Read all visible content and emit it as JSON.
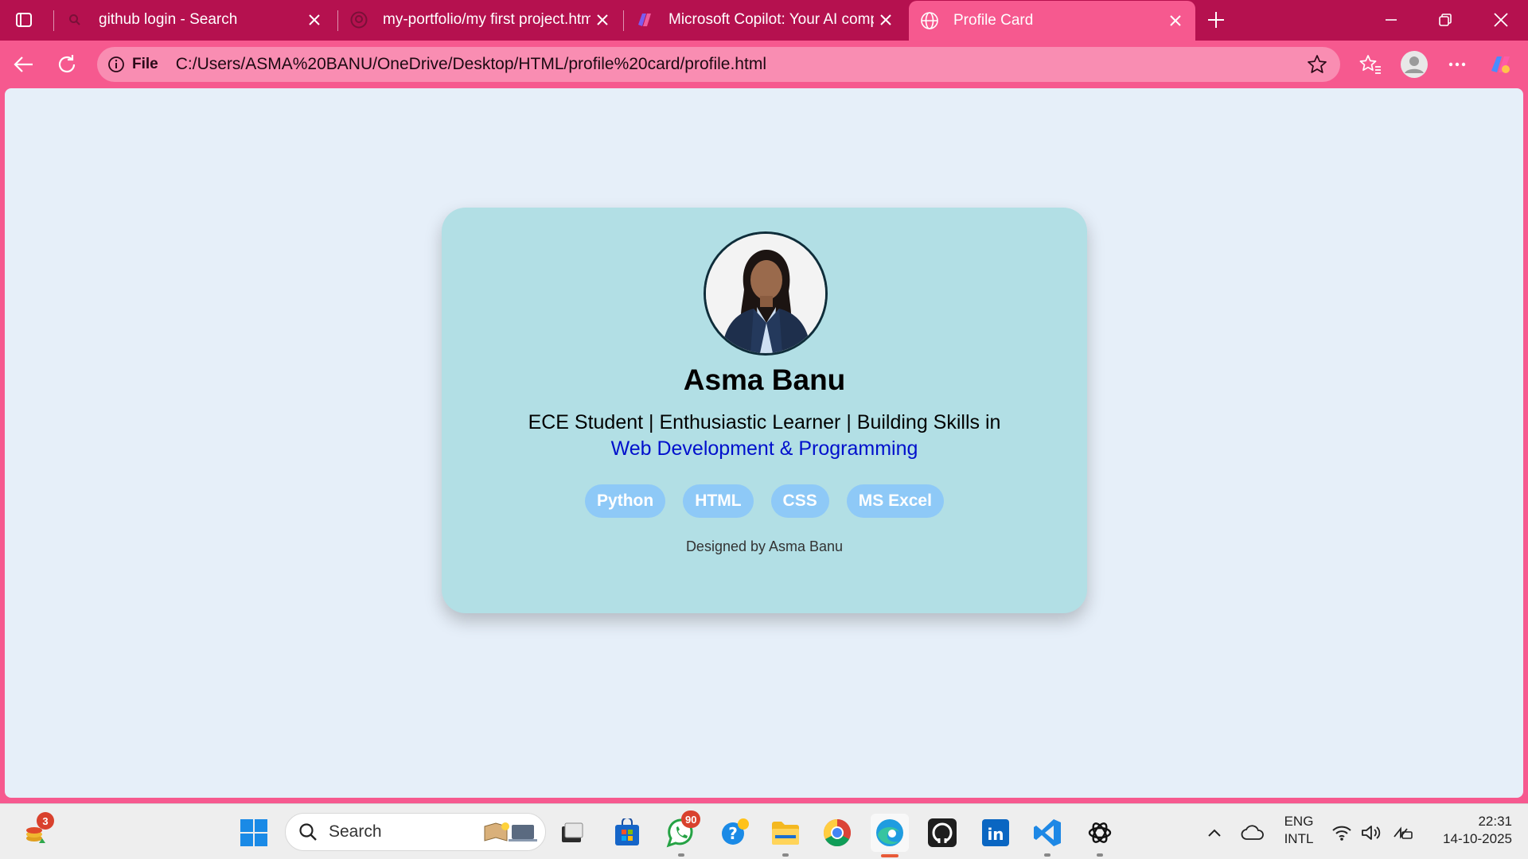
{
  "browser": {
    "tabs": [
      {
        "title": "github login - Search",
        "icon": "search-icon"
      },
      {
        "title": "my-portfolio/my first project.html",
        "icon": "github-icon"
      },
      {
        "title": "Microsoft Copilot: Your AI companion",
        "icon": "copilot-icon"
      },
      {
        "title": "Profile Card",
        "icon": "globe-icon",
        "active": true
      }
    ],
    "file_label": "File",
    "url": "C:/Users/ASMA%20BANU/OneDrive/Desktop/HTML/profile%20card/profile.html"
  },
  "profile": {
    "name": "Asma Banu",
    "bio_prefix": "ECE Student | Enthusiastic Learner | Building Skills in ",
    "bio_highlight": "Web Development & Programming",
    "skills": [
      "Python",
      "HTML",
      "CSS",
      "MS Excel"
    ],
    "footer": "Designed by Asma Banu"
  },
  "taskbar": {
    "widgets_badge": "3",
    "search_label": "Search",
    "whatsapp_badge": "90",
    "lang_line1": "ENG",
    "lang_line2": "INTL",
    "time": "22:31",
    "date": "14-10-2025"
  },
  "colors": {
    "tab_bar": "#b5114f",
    "toolbar": "#f6598f",
    "page_bg": "#e6eff9",
    "card_bg": "#b2dfe5",
    "chip_bg": "#8ec9f7",
    "highlight": "#0010cc"
  }
}
